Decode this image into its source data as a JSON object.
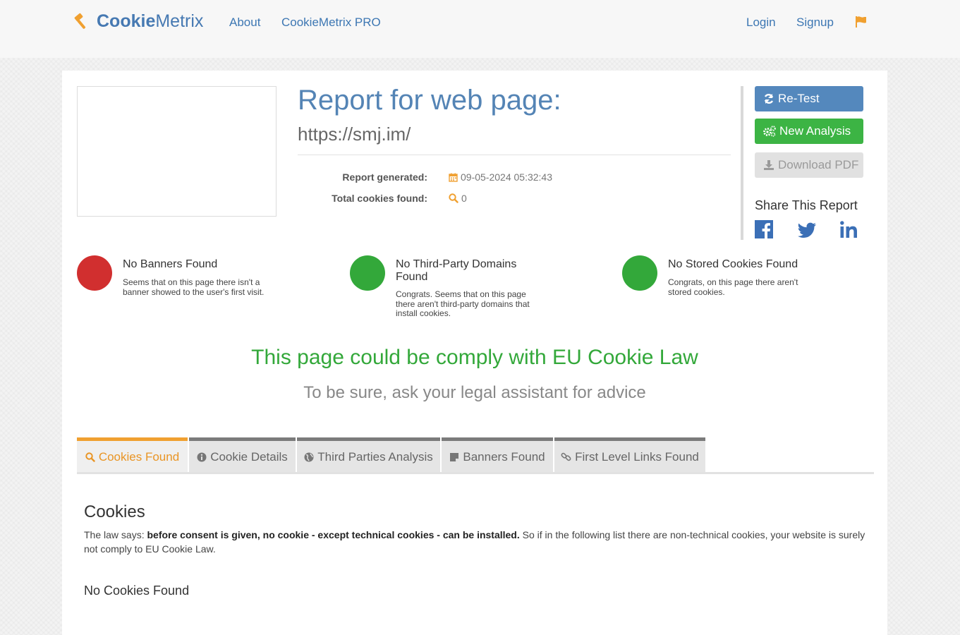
{
  "navbar": {
    "brand_bold": "Cookie",
    "brand_light": "Metrix",
    "links": [
      "About",
      "CookieMetrix PRO"
    ],
    "login": "Login",
    "signup": "Signup"
  },
  "report": {
    "title": "Report for web page:",
    "url": "https://smj.im/",
    "generated_label": "Report generated:",
    "generated_value": "09-05-2024 05:32:43",
    "total_label": "Total cookies found:",
    "total_value": "0"
  },
  "actions": {
    "retest": "Re-Test",
    "new_analysis": "New Analysis",
    "download_pdf": "Download PDF",
    "share_title": "Share This Report"
  },
  "statuses": [
    {
      "title": "No Banners Found",
      "desc": "Seems that on this page there isn't a banner showed to the user's first visit.",
      "color": "#d12f2f"
    },
    {
      "title": "No Third-Party Domains Found",
      "desc": "Congrats. Seems that on this page there aren't third-party domains that install cookies.",
      "color": "#33a83a"
    },
    {
      "title": "No Stored Cookies Found",
      "desc": "Congrats, on this page there aren't stored cookies.",
      "color": "#33a83a"
    }
  ],
  "verdict": {
    "headline": "This page could be comply with EU Cookie Law",
    "subline": "To be sure, ask your legal assistant for advice"
  },
  "tabs": [
    "Cookies Found",
    "Cookie Details",
    "Third Parties Analysis",
    "Banners Found",
    "First Level Links Found"
  ],
  "cookies_section": {
    "heading": "Cookies",
    "law_prefix": "The law says: ",
    "law_bold": "before consent is given, no cookie - except technical cookies - can be installed.",
    "law_suffix": " So if in the following list there are non-technical cookies, your website is surely not comply to EU Cookie Law.",
    "empty": "No Cookies Found"
  },
  "colors": {
    "accent_blue": "#4679b2",
    "accent_orange": "#f0a030",
    "success_green": "#33a83a",
    "danger_red": "#d12f2f"
  }
}
